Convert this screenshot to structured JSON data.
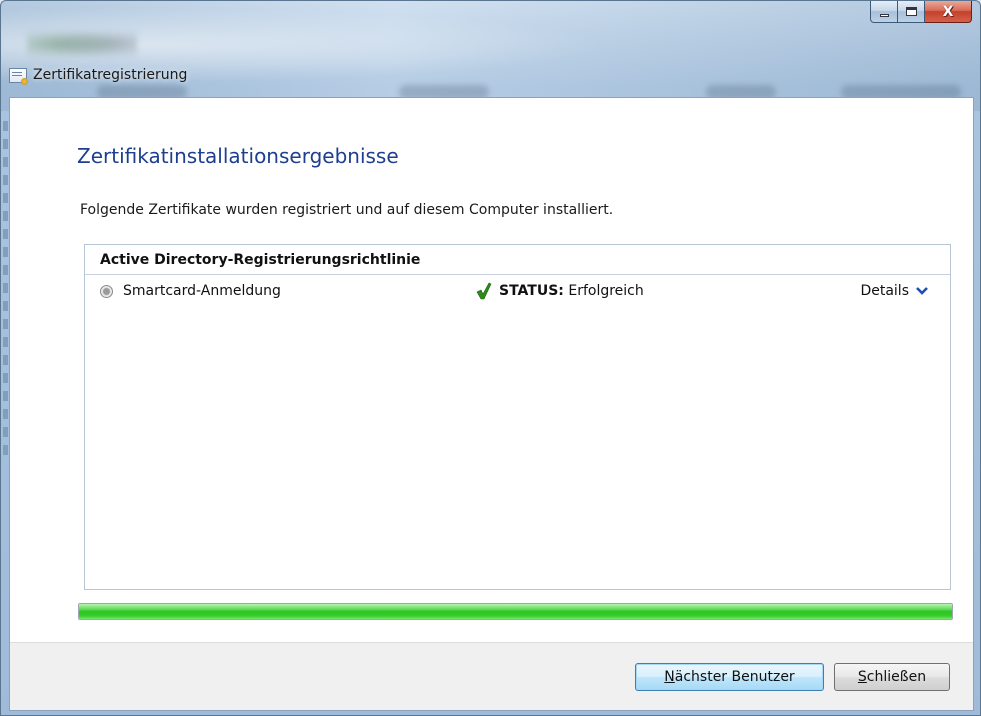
{
  "window": {
    "title": "Zertifikatregistrierung",
    "icon": "certificate-icon",
    "caption": {
      "minimize": "minimize-icon",
      "maximize": "maximize-icon",
      "close_glyph": "X"
    }
  },
  "page": {
    "heading": "Zertifikatinstallationsergebnisse",
    "intro": "Folgende Zertifikate wurden registriert und auf diesem Computer installiert."
  },
  "panel": {
    "header": "Active Directory-Registrierungsrichtlinie",
    "rows": [
      {
        "label": "Smartcard-Anmeldung",
        "status_label": "STATUS:",
        "status_value": "Erfolgreich",
        "status_icon": "check-icon",
        "details_label": "Details"
      }
    ]
  },
  "progress": {
    "percent": 100,
    "color": "#2fc324"
  },
  "footer": {
    "next_user_mnemonic": "N",
    "next_user_rest": "ächster Benutzer",
    "close_mnemonic": "S",
    "close_rest": "chließen"
  },
  "colors": {
    "heading": "#1e3f8f",
    "accent_chevron": "#1f4fb5",
    "success": "#2f8a1c"
  }
}
